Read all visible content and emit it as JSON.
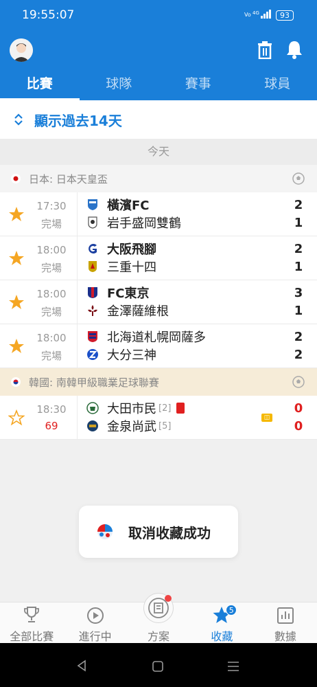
{
  "status_bar": {
    "time": "19:55:07",
    "network": "4G",
    "battery": "93"
  },
  "tabs": [
    {
      "label": "比賽",
      "active": true
    },
    {
      "label": "球隊",
      "active": false
    },
    {
      "label": "賽事",
      "active": false
    },
    {
      "label": "球員",
      "active": false
    }
  ],
  "filter": {
    "label": "顯示過去14天"
  },
  "day_header": "今天",
  "leagues": [
    {
      "name": "日本: 日本天皇盃",
      "country": "japan"
    },
    {
      "name": "韓國: 南韓甲級職業足球聯賽",
      "country": "korea"
    }
  ],
  "matches": [
    {
      "time": "17:30",
      "status": "完場",
      "starred": true,
      "home": {
        "name": "橫濱FC",
        "score": "2",
        "bold": true
      },
      "away": {
        "name": "岩手盛岡雙鶴",
        "score": "1",
        "bold": false
      }
    },
    {
      "time": "18:00",
      "status": "完場",
      "starred": true,
      "home": {
        "name": "大阪飛腳",
        "score": "2",
        "bold": true
      },
      "away": {
        "name": "三重十四",
        "score": "1",
        "bold": false
      }
    },
    {
      "time": "18:00",
      "status": "完場",
      "starred": true,
      "home": {
        "name": "FC東京",
        "score": "3",
        "bold": true
      },
      "away": {
        "name": "金澤薩維根",
        "score": "1",
        "bold": false
      }
    },
    {
      "time": "18:00",
      "status": "完場",
      "starred": true,
      "home": {
        "name": "北海道札幌岡薩多",
        "score": "2",
        "bold": false
      },
      "away": {
        "name": "大分三神",
        "score": "2",
        "bold": false
      }
    },
    {
      "time": "18:30",
      "status": "69",
      "starred": false,
      "live": true,
      "home": {
        "name": "大田市民",
        "rank": "[2]",
        "score": "0",
        "red_card": true
      },
      "away": {
        "name": "金泉尚武",
        "rank": "[5]",
        "score": "0"
      }
    }
  ],
  "toast": {
    "message": "取消收藏成功"
  },
  "bottom_nav": [
    {
      "label": "全部比賽",
      "icon": "trophy-icon"
    },
    {
      "label": "進行中",
      "icon": "play-icon"
    },
    {
      "label": "方案",
      "icon": "plan-icon"
    },
    {
      "label": "收藏",
      "icon": "star-icon",
      "active": true,
      "badge": "5"
    },
    {
      "label": "數據",
      "icon": "chart-icon"
    }
  ],
  "colors": {
    "primary": "#1a7fd9",
    "star": "#f5a623",
    "live": "#e02020"
  }
}
